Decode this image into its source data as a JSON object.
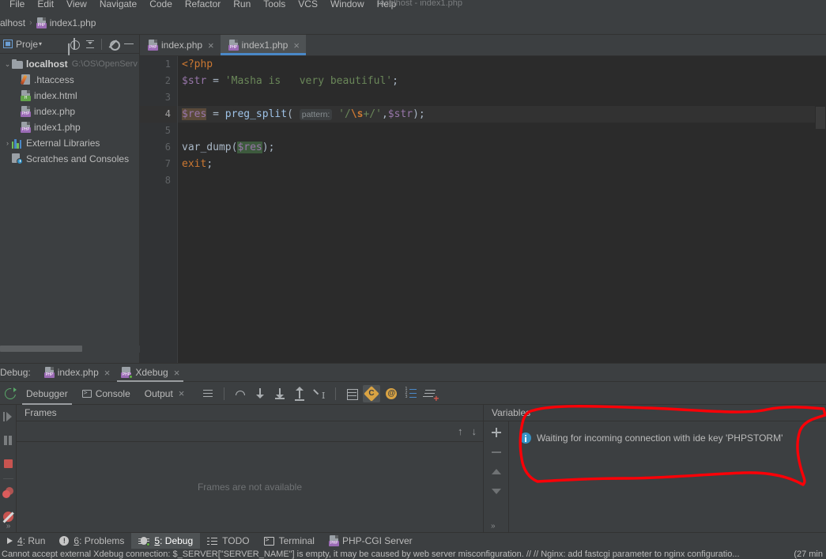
{
  "window": {
    "title": "localhost - index1.php"
  },
  "menubar": {
    "items": [
      "File",
      "Edit",
      "View",
      "Navigate",
      "Code",
      "Refactor",
      "Run",
      "Tools",
      "VCS",
      "Window",
      "Help"
    ]
  },
  "breadcrumb": {
    "root": "alhost",
    "separator": "›",
    "file": "index1.php",
    "file_icon": "php-file-icon"
  },
  "project_panel": {
    "title": "Proje",
    "title_caret": "▾",
    "toolbar_icons": [
      "locate-target-icon",
      "collapse-all-icon",
      "settings-gear-icon",
      "minimize-icon"
    ],
    "tree": [
      {
        "label": "localhost",
        "sub": "G:\\OS\\OpenServ",
        "icon": "folder-icon",
        "arrow": "⌄",
        "bold": true,
        "indent": 0
      },
      {
        "label": ".htaccess",
        "sub": "",
        "icon": "htaccess-file-icon",
        "arrow": "",
        "bold": false,
        "indent": 1
      },
      {
        "label": "index.html",
        "sub": "",
        "icon": "html-file-icon",
        "arrow": "",
        "bold": false,
        "indent": 1
      },
      {
        "label": "index.php",
        "sub": "",
        "icon": "php-file-icon",
        "arrow": "",
        "bold": false,
        "indent": 1
      },
      {
        "label": "index1.php",
        "sub": "",
        "icon": "php-file-icon",
        "arrow": "",
        "bold": false,
        "indent": 1
      },
      {
        "label": "External Libraries",
        "sub": "",
        "icon": "libraries-icon",
        "arrow": "›",
        "bold": false,
        "indent": 0
      },
      {
        "label": "Scratches and Consoles",
        "sub": "",
        "icon": "scratches-icon",
        "arrow": "",
        "bold": false,
        "indent": 0
      }
    ]
  },
  "editor": {
    "tabs": [
      {
        "label": "index.php",
        "icon": "php-file-icon",
        "active": false,
        "close": "×"
      },
      {
        "label": "index1.php",
        "icon": "php-file-icon",
        "active": true,
        "close": "×"
      }
    ],
    "line_numbers": [
      "1",
      "2",
      "3",
      "4",
      "5",
      "6",
      "7",
      "8"
    ],
    "current_line": 4,
    "code_lines": [
      {
        "n": 1,
        "tokens": [
          {
            "t": "<?php",
            "c": "tok-kw"
          }
        ]
      },
      {
        "n": 2,
        "tokens": [
          {
            "t": "$str",
            "c": "tok-var"
          },
          {
            "t": " = ",
            "c": "tok-plain"
          },
          {
            "t": "'Masha is   very beautiful'",
            "c": "tok-str"
          },
          {
            "t": ";",
            "c": "tok-plain"
          }
        ]
      },
      {
        "n": 3,
        "tokens": []
      },
      {
        "n": 4,
        "tokens": [
          {
            "t": "$res",
            "c": "tok-var-hl"
          },
          {
            "t": " = ",
            "c": "tok-plain"
          },
          {
            "t": "preg_split",
            "c": "tok-fn"
          },
          {
            "t": "( ",
            "c": "tok-plain"
          },
          {
            "t": "pattern:",
            "c": "inlay"
          },
          {
            "t": " ",
            "c": "tok-plain"
          },
          {
            "t": "'/",
            "c": "tok-str"
          },
          {
            "t": "\\s",
            "c": "tok-esc"
          },
          {
            "t": "+/'",
            "c": "tok-str"
          },
          {
            "t": ",",
            "c": "tok-plain"
          },
          {
            "t": "$str",
            "c": "tok-var"
          },
          {
            "t": ");",
            "c": "tok-plain"
          }
        ]
      },
      {
        "n": 5,
        "tokens": []
      },
      {
        "n": 6,
        "tokens": [
          {
            "t": "var_dump",
            "c": "tok-plain"
          },
          {
            "t": "(",
            "c": "tok-plain"
          },
          {
            "t": "$res",
            "c": "tok-var-hl2"
          },
          {
            "t": ");",
            "c": "tok-plain"
          }
        ]
      },
      {
        "n": 7,
        "tokens": [
          {
            "t": "exit",
            "c": "tok-kw"
          },
          {
            "t": ";",
            "c": "tok-plain"
          }
        ]
      },
      {
        "n": 8,
        "tokens": []
      }
    ]
  },
  "debug": {
    "label": "Debug:",
    "tabs": [
      {
        "label": "index.php",
        "icon": "php-file-icon",
        "active": false,
        "close": "×"
      },
      {
        "label": "Xdebug",
        "icon": "xdebug-icon",
        "active": true,
        "close": "×"
      }
    ],
    "subtabs": [
      {
        "label": "Debugger",
        "active": true,
        "close": ""
      },
      {
        "label": "Console",
        "active": false,
        "close": "",
        "icon": "console-icon"
      },
      {
        "label": "Output",
        "active": false,
        "close": "×"
      }
    ],
    "rerun_icon": "rerun-icon",
    "toolbar_icons": [
      "menu-hamburger-icon",
      "step-over-icon",
      "step-into-icon",
      "force-step-into-icon",
      "step-out-icon",
      "run-to-cursor-icon",
      "evaluate-expression-icon",
      "watch-diamond-icon",
      "at-sign-icon",
      "numbered-list-icon",
      "add-to-list-icon"
    ],
    "gutter_icons": [
      "resume-program-icon",
      "pause-program-icon",
      "stop-program-icon",
      "view-breakpoints-icon",
      "mute-breakpoints-icon"
    ],
    "gutter_chevron": "»",
    "frames": {
      "title": "Frames",
      "empty_text": "Frames are not available",
      "up_arrow": "↑",
      "down_arrow": "↓"
    },
    "variables": {
      "title": "Variables",
      "toolbar_icons": [
        "add-watch-icon",
        "remove-watch-icon",
        "move-up-icon",
        "move-down-icon"
      ],
      "chevron": "»",
      "message": "Waiting for incoming connection with ide key 'PHPSTORM'",
      "message_icon": "info-icon"
    }
  },
  "annotation": {
    "color": "#fb0007",
    "shape": "hand-drawn-red-ellipse"
  },
  "bottom_toolbar": {
    "items": [
      {
        "num": "4",
        "label": ": Run",
        "icon": "run-play-icon",
        "active": false
      },
      {
        "num": "6",
        "label": ": Problems",
        "icon": "problems-icon",
        "active": false
      },
      {
        "num": "5",
        "label": ": Debug",
        "icon": "debug-bug-icon",
        "active": true
      },
      {
        "num": "",
        "label": "TODO",
        "icon": "todo-list-icon",
        "active": false
      },
      {
        "num": "",
        "label": "Terminal",
        "icon": "terminal-icon",
        "active": false
      },
      {
        "num": "",
        "label": "PHP-CGI Server",
        "icon": "php-file-icon",
        "active": false
      }
    ]
  },
  "statusbar": {
    "message": "Cannot accept external Xdebug connection: $_SERVER[\"SERVER_NAME\"] is empty, it may be caused by web server misconfiguration. // // Nginx: add fastcgi parameter to nginx configuratio...",
    "time": "(27 min"
  }
}
